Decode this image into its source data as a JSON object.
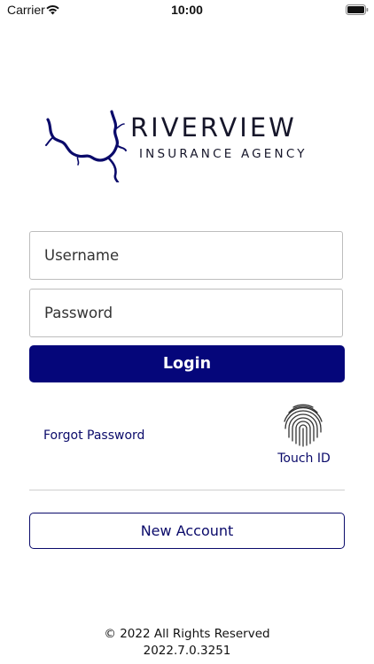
{
  "status_bar": {
    "carrier": "Carrier",
    "time": "10:00",
    "wifi_icon": "wifi-icon",
    "battery_icon": "battery-icon"
  },
  "logo": {
    "name": "RIVERVIEW",
    "tagline": "INSURANCE AGENCY",
    "color": "#16162a",
    "river_color": "#0a0a6a"
  },
  "form": {
    "username_placeholder": "Username",
    "password_placeholder": "Password",
    "login_label": "Login",
    "forgot_password_label": "Forgot Password",
    "touch_id_label": "Touch ID",
    "new_account_label": "New Account"
  },
  "footer": {
    "copyright": "© 2022 All Rights Reserved",
    "version": "2022.7.0.3251"
  },
  "colors": {
    "primary": "#05067a",
    "link": "#0a0a6a"
  }
}
